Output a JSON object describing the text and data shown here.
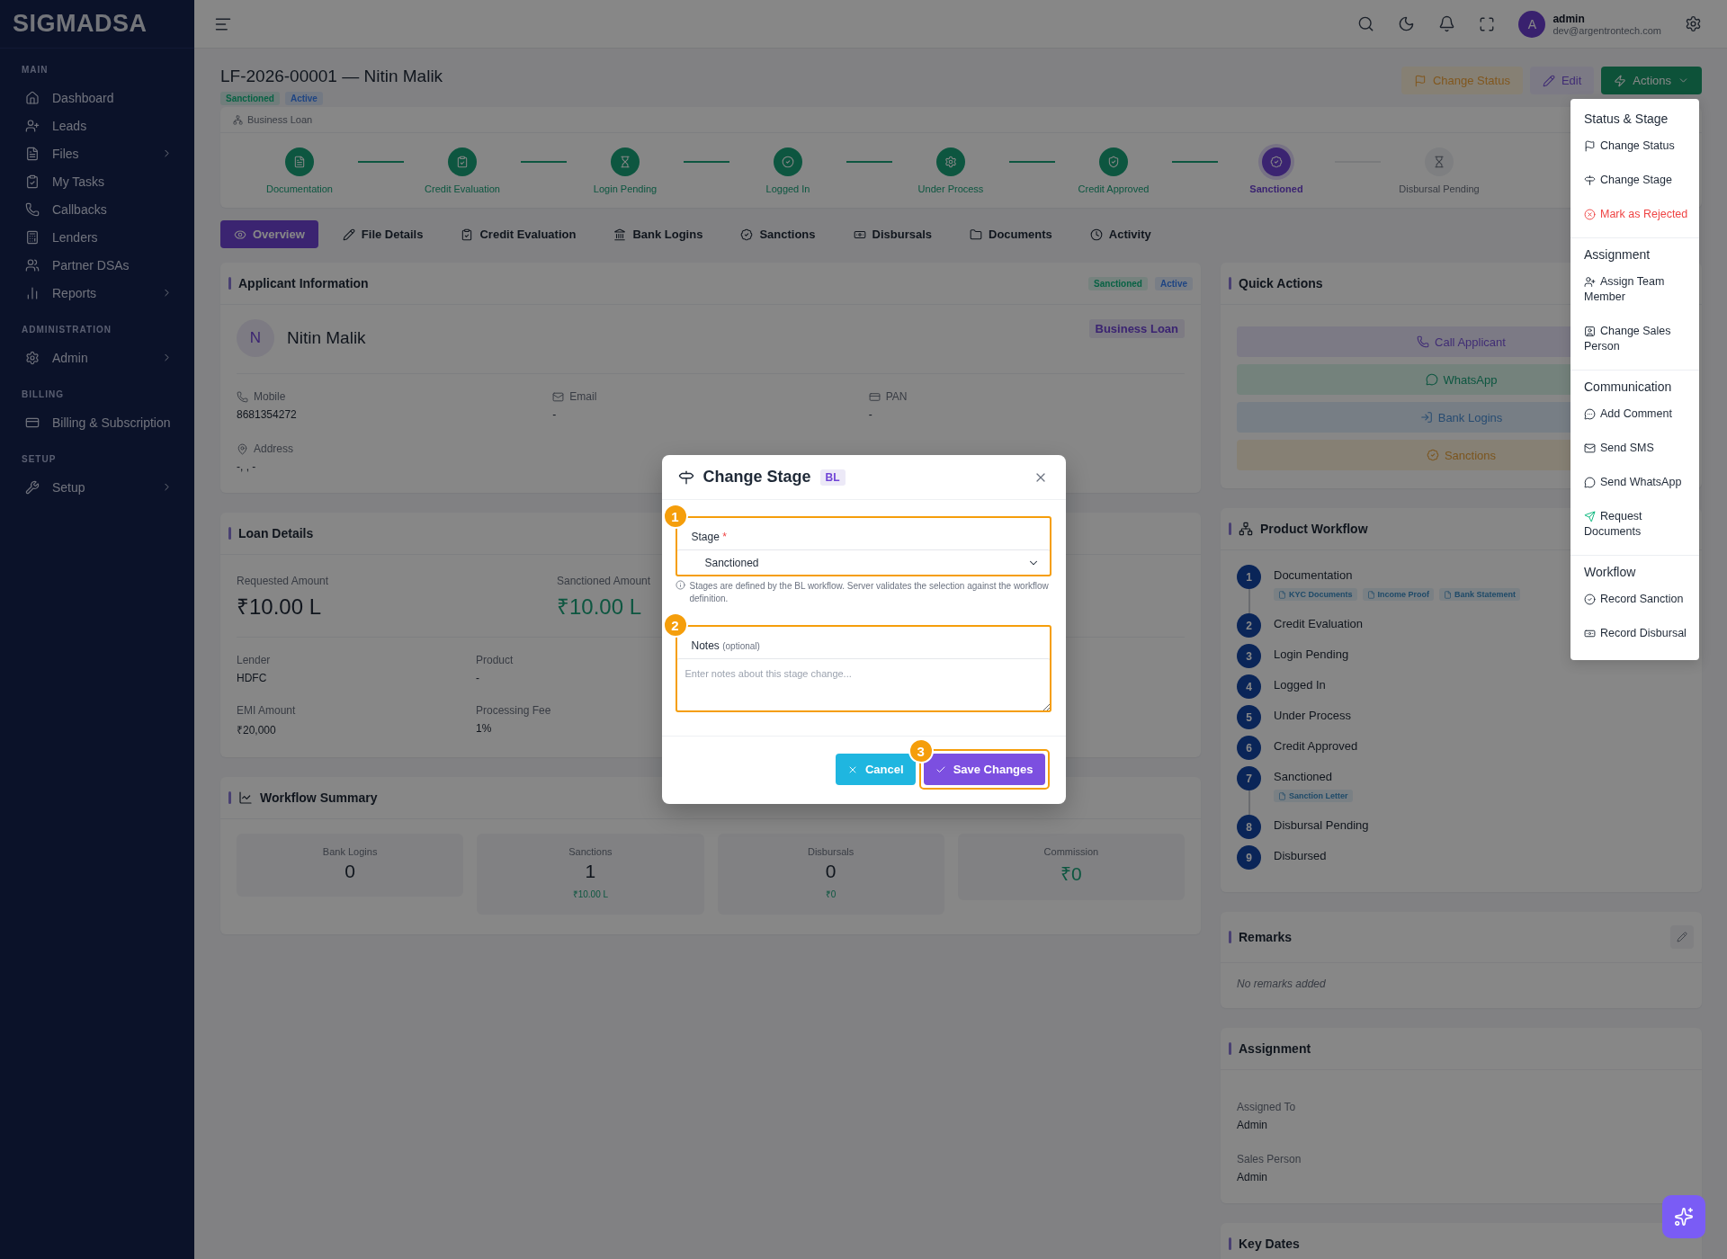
{
  "brand": "SIGMADSA",
  "sidebar": [
    {
      "title": "MAIN",
      "items": [
        {
          "label": "Dashboard",
          "submenu": false
        },
        {
          "label": "Leads",
          "submenu": false
        },
        {
          "label": "Files",
          "submenu": true
        },
        {
          "label": "My Tasks",
          "submenu": false
        },
        {
          "label": "Callbacks",
          "submenu": false
        },
        {
          "label": "Lenders",
          "submenu": false
        },
        {
          "label": "Partner DSAs",
          "submenu": false
        },
        {
          "label": "Reports",
          "submenu": true
        }
      ]
    },
    {
      "title": "ADMINISTRATION",
      "items": [
        {
          "label": "Admin",
          "submenu": true
        }
      ]
    },
    {
      "title": "BILLING",
      "items": [
        {
          "label": "Billing & Subscription",
          "submenu": false
        }
      ]
    },
    {
      "title": "SETUP",
      "items": [
        {
          "label": "Setup",
          "submenu": true
        }
      ]
    }
  ],
  "topbar": {
    "avatar": "A",
    "user": "admin",
    "email": "dev@argentrontech.com"
  },
  "header": {
    "title": "LF-2026-00001 — Nitin Malik",
    "badges": [
      {
        "label": "Sanctioned",
        "kind": "success"
      },
      {
        "label": "Active",
        "kind": "info"
      }
    ],
    "buttons": [
      {
        "label": "Change Status",
        "kind": "warning"
      },
      {
        "label": "Edit",
        "kind": "soft"
      },
      {
        "label": "Actions",
        "kind": "success"
      }
    ]
  },
  "stepper": {
    "product": "Business Loan",
    "steps": [
      {
        "label": "Documentation",
        "completed": true,
        "selected": false
      },
      {
        "label": "Credit Evaluation",
        "completed": true,
        "selected": false
      },
      {
        "label": "Login Pending",
        "completed": true,
        "selected": false
      },
      {
        "label": "Logged In",
        "completed": true,
        "selected": false
      },
      {
        "label": "Under Process",
        "completed": true,
        "selected": false
      },
      {
        "label": "Credit Approved",
        "completed": true,
        "selected": false
      },
      {
        "label": "Sanctioned",
        "completed": false,
        "selected": true
      },
      {
        "label": "Disbursal Pending",
        "completed": false,
        "selected": false
      }
    ]
  },
  "tabs": [
    {
      "label": "Overview",
      "selected": true
    },
    {
      "label": "File Details",
      "selected": false
    },
    {
      "label": "Credit Evaluation",
      "selected": false
    },
    {
      "label": "Bank Logins",
      "selected": false
    },
    {
      "label": "Sanctions",
      "selected": false
    },
    {
      "label": "Disbursals",
      "selected": false
    },
    {
      "label": "Documents",
      "selected": false
    },
    {
      "label": "Activity",
      "selected": false
    }
  ],
  "applicant": {
    "title": "Applicant Information",
    "badges": [
      {
        "label": "Sanctioned",
        "kind": "success"
      },
      {
        "label": "Active",
        "kind": "info"
      }
    ],
    "initial": "N",
    "name": "Nitin Malik",
    "product_badge": "Business Loan",
    "fields": [
      {
        "label": "Mobile",
        "value": "8681354272"
      },
      {
        "label": "Email",
        "value": "-"
      },
      {
        "label": "PAN",
        "value": "-"
      },
      {
        "label": "Address",
        "value": "-, , -"
      }
    ]
  },
  "loan": {
    "title": "Loan Details",
    "amounts": [
      {
        "label": "Requested Amount",
        "value": "₹10.00 L",
        "kind": "plain"
      },
      {
        "label": "Sanctioned Amount",
        "value": "₹10.00 L",
        "kind": "positive"
      }
    ],
    "fields": [
      {
        "label": "Lender",
        "value": "HDFC"
      },
      {
        "label": "Product",
        "value": "-"
      },
      {
        "label": "EMI Amount",
        "value": "₹20,000"
      },
      {
        "label": "Processing Fee",
        "value": "1%"
      }
    ]
  },
  "summary": {
    "title": "Workflow Summary",
    "stats": [
      {
        "label": "Bank Logins",
        "value": "0",
        "kind": "plain"
      },
      {
        "label": "Sanctions",
        "value": "1",
        "sub": "₹10.00 L",
        "kind": "plain"
      },
      {
        "label": "Disbursals",
        "value": "0",
        "sub": "₹0",
        "kind": "plain"
      },
      {
        "label": "Commission",
        "value": "₹0",
        "kind": "positive"
      }
    ]
  },
  "quick_actions": {
    "title": "Quick Actions",
    "buttons": [
      {
        "label": "Call Applicant",
        "kind": "purple"
      },
      {
        "label": "WhatsApp",
        "kind": "green"
      },
      {
        "label": "Bank Logins",
        "kind": "blue"
      },
      {
        "label": "Sanctions",
        "kind": "amber"
      }
    ]
  },
  "product_workflow": {
    "title": "Product Workflow",
    "steps": [
      {
        "number": "1",
        "label": "Documentation",
        "documents": [
          "KYC Documents",
          "Income Proof",
          "Bank Statement"
        ]
      },
      {
        "number": "2",
        "label": "Credit Evaluation"
      },
      {
        "number": "3",
        "label": "Login Pending"
      },
      {
        "number": "4",
        "label": "Logged In"
      },
      {
        "number": "5",
        "label": "Under Process"
      },
      {
        "number": "6",
        "label": "Credit Approved"
      },
      {
        "number": "7",
        "label": "Sanctioned",
        "documents": [
          "Sanction Letter"
        ]
      },
      {
        "number": "8",
        "label": "Disbursal Pending"
      },
      {
        "number": "9",
        "label": "Disbursed"
      }
    ]
  },
  "remarks": {
    "title": "Remarks",
    "empty": "No remarks added"
  },
  "assignment": {
    "title": "Assignment",
    "fields": [
      {
        "label": "Assigned To",
        "value": "Admin"
      },
      {
        "label": "Sales Person",
        "value": "Admin"
      }
    ]
  },
  "key_dates": {
    "title": "Key Dates"
  },
  "actions_menu": [
    {
      "title": "Status & Stage",
      "items": [
        {
          "label": "Change Status",
          "kind": "normal"
        },
        {
          "label": "Change Stage",
          "kind": "normal"
        },
        {
          "label": "Mark as Rejected",
          "kind": "danger"
        }
      ]
    },
    {
      "title": "Assignment",
      "items": [
        {
          "label": "Assign Team Member",
          "kind": "normal"
        },
        {
          "label": "Change Sales Person",
          "kind": "normal"
        }
      ]
    },
    {
      "title": "Communication",
      "items": [
        {
          "label": "Add Comment",
          "kind": "normal"
        },
        {
          "label": "Send SMS",
          "kind": "normal"
        },
        {
          "label": "Send WhatsApp",
          "kind": "normal"
        },
        {
          "label": "Request Documents",
          "kind": "accent"
        }
      ]
    },
    {
      "title": "Workflow",
      "items": [
        {
          "label": "Record Sanction",
          "kind": "normal"
        },
        {
          "label": "Record Disbursal",
          "kind": "normal"
        }
      ]
    }
  ],
  "modal": {
    "title": "Change Stage",
    "badge": "BL",
    "stage_label": "Stage",
    "required_mark": "*",
    "stage_value": "Sanctioned",
    "help": "Stages are defined by the BL workflow. Server validates the selection against the workflow definition.",
    "notes_label": "Notes",
    "notes_hint": "(optional)",
    "notes_placeholder": "Enter notes about this stage change...",
    "buttons": [
      {
        "label": "Cancel",
        "kind": "secondary"
      },
      {
        "label": "Save Changes",
        "kind": "primary"
      }
    ],
    "annotations": [
      "1",
      "2",
      "3"
    ]
  }
}
